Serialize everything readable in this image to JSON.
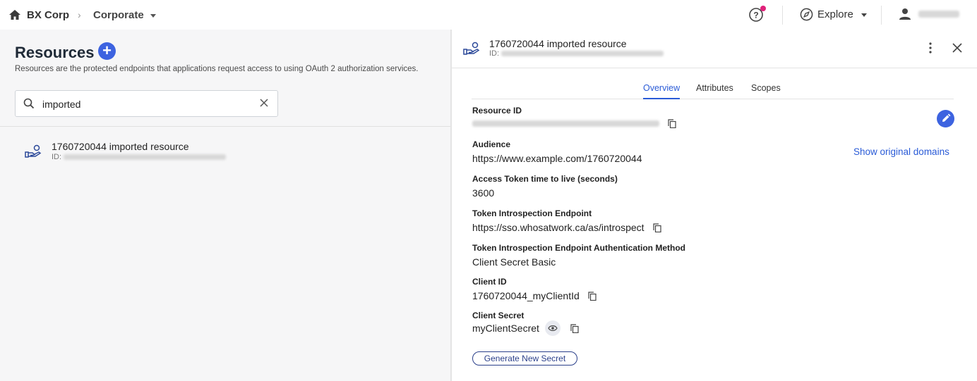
{
  "topbar": {
    "org": "BX Corp",
    "environment": "Corporate",
    "explore_label": "Explore",
    "colors": {
      "notification_dot": "#e0217a"
    }
  },
  "left": {
    "title": "Resources",
    "add_symbol": "+",
    "description": "Resources are the protected endpoints that applications request access to using OAuth 2 authorization services.",
    "search": {
      "value": "imported"
    },
    "items": [
      {
        "name": "1760720044 imported resource",
        "id_label": "ID:"
      }
    ]
  },
  "detail": {
    "title": "1760720044 imported resource",
    "id_label": "ID:",
    "tabs": [
      {
        "label": "Overview",
        "active": true
      },
      {
        "label": "Attributes",
        "active": false
      },
      {
        "label": "Scopes",
        "active": false
      }
    ],
    "show_original_domains": "Show original domains",
    "fields": {
      "resource_id": {
        "label": "Resource ID"
      },
      "audience": {
        "label": "Audience",
        "value": "https://www.example.com/1760720044"
      },
      "ttl": {
        "label": "Access Token time to live (seconds)",
        "value": "3600"
      },
      "introspection": {
        "label": "Token Introspection Endpoint",
        "value": "https://sso.whosatwork.ca/as/introspect"
      },
      "auth_method": {
        "label": "Token Introspection Endpoint Authentication Method",
        "value": "Client Secret Basic"
      },
      "client_id": {
        "label": "Client ID",
        "value": "1760720044_myClientId"
      },
      "client_secret": {
        "label": "Client Secret",
        "value": "myClientSecret"
      }
    },
    "generate_button": "Generate New Secret"
  },
  "colors": {
    "accent": "#3d63e0",
    "link": "#2a5bd7"
  }
}
